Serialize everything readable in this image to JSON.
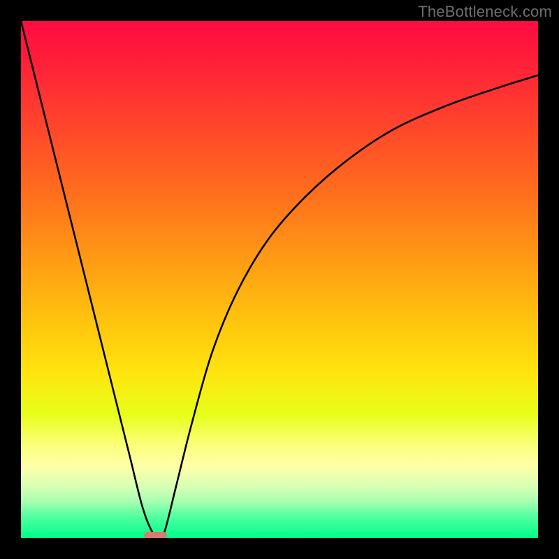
{
  "watermark": "TheBottleneck.com",
  "colors": {
    "curve_stroke": "#000000",
    "marker_fill": "#d87a6f",
    "frame_bg": "#000000"
  },
  "chart_data": {
    "type": "line",
    "title": "",
    "xlabel": "",
    "ylabel": "",
    "xlim": [
      0,
      100
    ],
    "ylim": [
      0,
      100
    ],
    "grid": false,
    "legend": false,
    "notes": "V-shaped bottleneck curve over red→yellow→green vertical gradient. No axes/ticks shown. y estimated from vertical position (100=top, 0=bottom).",
    "series": [
      {
        "name": "bottleneck-curve",
        "x": [
          0,
          3,
          6,
          9,
          12,
          15,
          18,
          21,
          23.5,
          25.5,
          27,
          28,
          30,
          33,
          37,
          42,
          48,
          55,
          63,
          72,
          82,
          92,
          100
        ],
        "y": [
          100,
          88,
          76,
          64,
          52,
          40,
          28,
          16,
          6,
          1,
          0,
          2,
          10,
          22,
          36,
          48,
          58,
          66,
          73,
          79,
          83.5,
          87,
          89.5
        ]
      }
    ],
    "marker": {
      "x_center": 26,
      "x_halfwidth": 2.2,
      "y": 0.5
    }
  }
}
